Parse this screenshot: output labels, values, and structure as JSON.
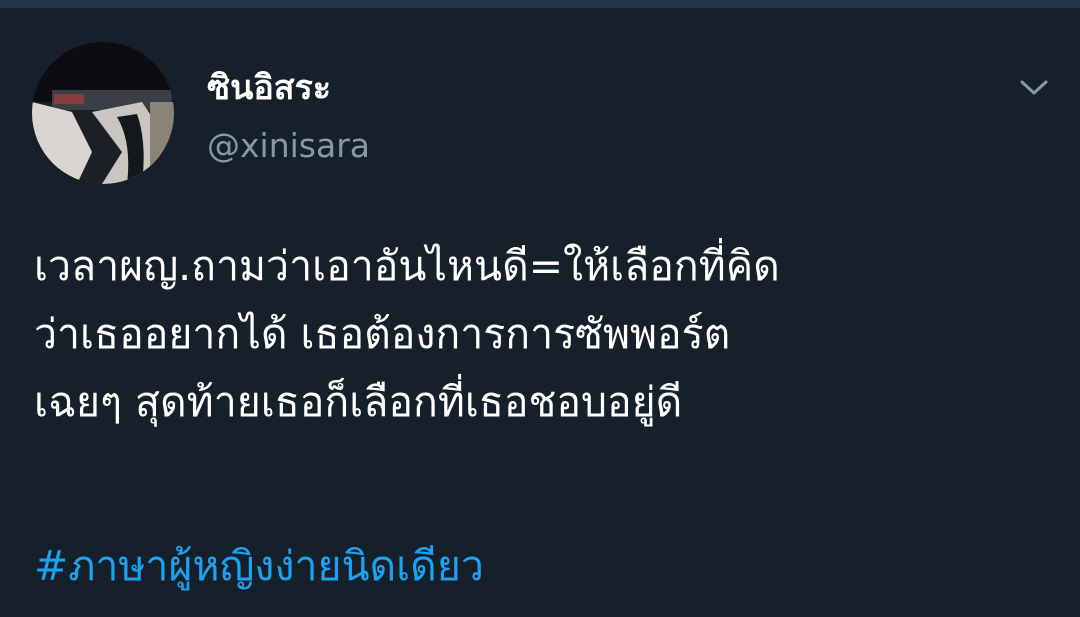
{
  "tweet": {
    "display_name": "ซินอิสระ",
    "handle": "@xinisara",
    "body_lines": [
      "เวลาผญ.ถามว่าเอาอันไหนดี=ให้เลือกที่คิด",
      "ว่าเธออยากได้ เธอต้องการการซัพพอร์ต",
      "เฉยๆ สุดท้ายเธอก็เลือกที่เธอชอบอยู่ดี"
    ],
    "hashtag": "#ภาษาผู้หญิงง่ายนิดเดียว"
  },
  "icons": {
    "menu": "chevron-down-icon",
    "avatar": "profile-photo"
  },
  "colors": {
    "background": "#15202b",
    "text": "#ffffff",
    "secondary_text": "#8899a6",
    "link": "#1da1f2"
  }
}
